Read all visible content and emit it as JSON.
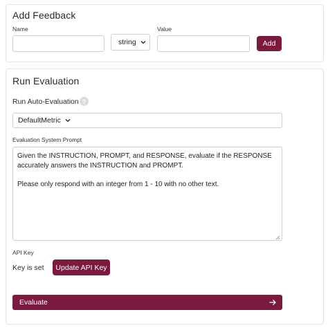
{
  "feedback": {
    "title": "Add Feedback",
    "name_label": "Name",
    "name_value": "",
    "type_select": "string",
    "value_label": "Value",
    "value_value": "",
    "add_button": "Add"
  },
  "evaluation": {
    "title": "Run Evaluation",
    "auto_eval_label": "Run Auto-Evaluation",
    "help_icon_glyph": "?",
    "metric_select": "DefaultMetric",
    "system_prompt_label": "Evaluation System Prompt",
    "system_prompt_lines": [
      "Given the INSTRUCTION, PROMPT, and RESPONSE, evaluate if the RESPONSE accurately answers the INSTRUCTION and PROMPT.",
      "Please only respond with an integer from 1 - 10 with no other text."
    ],
    "api_key_label": "API Key",
    "key_status": "Key is set",
    "update_key_button": "Update API Key",
    "evaluate_button": "Evaluate"
  },
  "colors": {
    "accent": "#7a1a3f",
    "border": "#e4e4e4"
  },
  "icons": {
    "select_chevron": "chevron-down-icon",
    "help": "help-circle-icon",
    "evaluate_arrow": "arrow-right-icon"
  }
}
